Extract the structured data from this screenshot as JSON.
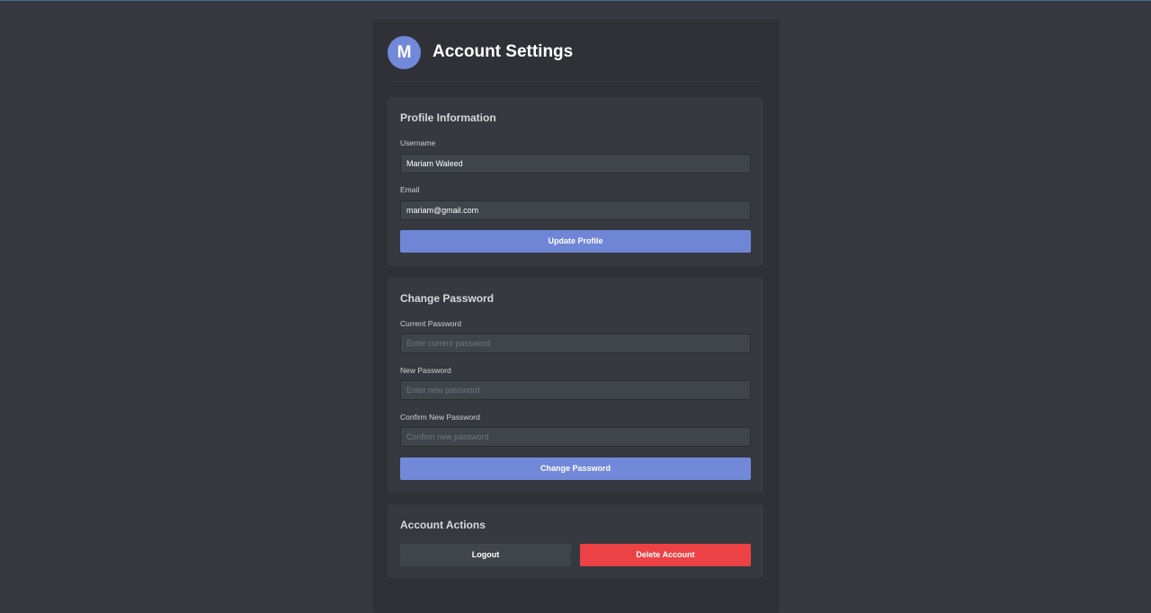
{
  "header": {
    "avatar_initial": "M",
    "title": "Account Settings"
  },
  "profile": {
    "title": "Profile Information",
    "username_label": "Username",
    "username_value": "Mariam Waleed",
    "email_label": "Email",
    "email_value": "mariam@gmail.com",
    "update_label": "Update Profile"
  },
  "password": {
    "title": "Change Password",
    "current_label": "Current Password",
    "current_placeholder": "Enter current password",
    "new_label": "New Password",
    "new_placeholder": "Enter new password",
    "confirm_label": "Confirm New Password",
    "confirm_placeholder": "Confirm new password",
    "change_label": "Change Password"
  },
  "actions": {
    "title": "Account Actions",
    "logout_label": "Logout",
    "delete_label": "Delete Account"
  },
  "colors": {
    "background": "#36393f",
    "panel": "#2f3136",
    "accent": "#7289da",
    "danger": "#ed4245"
  }
}
